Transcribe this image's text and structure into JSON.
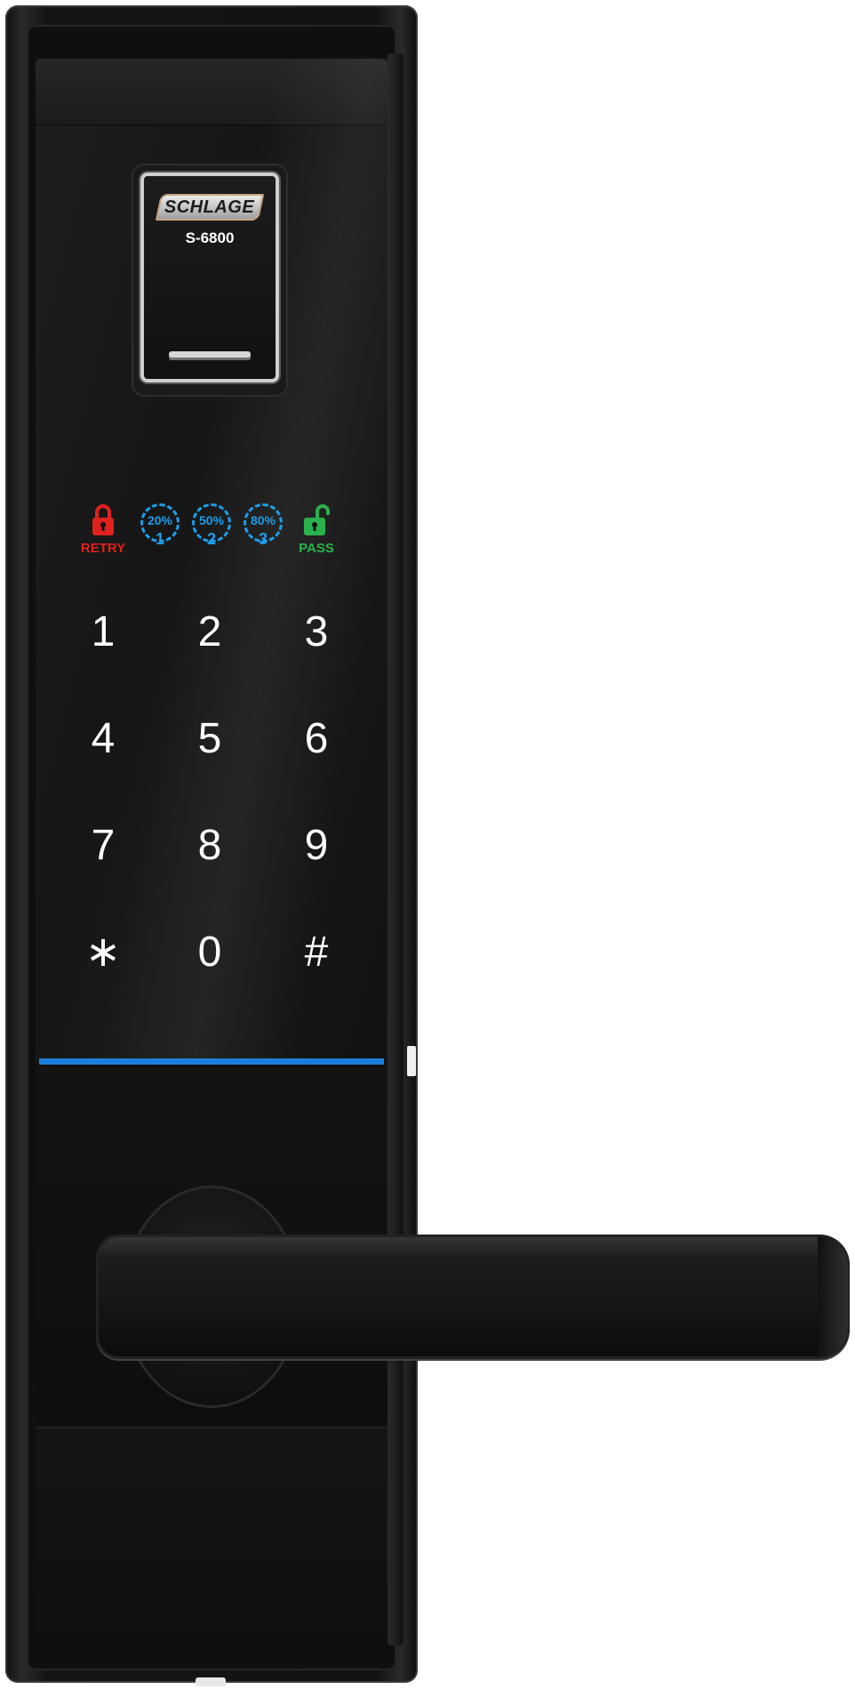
{
  "brand": {
    "name": "SCHLAGE",
    "model": "S-6800"
  },
  "indicators": {
    "retry": {
      "label": "RETRY",
      "color": "#e0221f"
    },
    "level1": {
      "percent": "20%",
      "number": "1"
    },
    "level2": {
      "percent": "50%",
      "number": "2"
    },
    "level3": {
      "percent": "80%",
      "number": "3"
    },
    "pass": {
      "label": "PASS",
      "color": "#2bb24c"
    },
    "level_color": "#1e9ce8"
  },
  "keypad": {
    "keys": [
      "1",
      "2",
      "3",
      "4",
      "5",
      "6",
      "7",
      "8",
      "9",
      "∗",
      "0",
      "#"
    ]
  },
  "accent_line_color": "#1a7fd8"
}
